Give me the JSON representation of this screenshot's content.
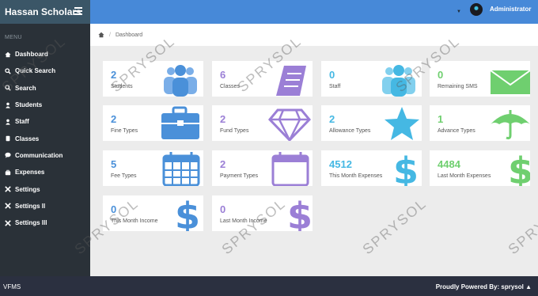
{
  "app": {
    "brand": "Hassan Scholars",
    "footer_left": "VFMS",
    "footer_right": "Proudly Powered By: sprysol"
  },
  "user": {
    "name": "Administrator"
  },
  "sidebar": {
    "menu_label": "MENU",
    "items": [
      {
        "label": "Dashboard",
        "icon": "home-icon"
      },
      {
        "label": "Quick Search",
        "icon": "search-icon"
      },
      {
        "label": "Search",
        "icon": "search-icon"
      },
      {
        "label": "Students",
        "icon": "user-icon"
      },
      {
        "label": "Staff",
        "icon": "user-icon"
      },
      {
        "label": "Classes",
        "icon": "book-icon"
      },
      {
        "label": "Communication",
        "icon": "chat-icon"
      },
      {
        "label": "Expenses",
        "icon": "briefcase-icon"
      },
      {
        "label": "Settings",
        "icon": "tools-icon"
      },
      {
        "label": "Settings ll",
        "icon": "tools-icon"
      },
      {
        "label": "Settings lll",
        "icon": "tools-icon"
      }
    ]
  },
  "breadcrumb": {
    "current": "Dashboard"
  },
  "cards": [
    {
      "value": "2",
      "label": "Students",
      "icon": "users-icon"
    },
    {
      "value": "6",
      "label": "Classes",
      "icon": "book-icon"
    },
    {
      "value": "0",
      "label": "Staff",
      "icon": "users-icon"
    },
    {
      "value": "0",
      "label": "Remaining SMS",
      "icon": "envelope-icon"
    },
    {
      "value": "2",
      "label": "Fine Types",
      "icon": "briefcase-icon"
    },
    {
      "value": "2",
      "label": "Fund Types",
      "icon": "diamond-icon"
    },
    {
      "value": "2",
      "label": "Allowance Types",
      "icon": "star-icon"
    },
    {
      "value": "1",
      "label": "Advance Types",
      "icon": "umbrella-icon"
    },
    {
      "value": "5",
      "label": "Fee Types",
      "icon": "calendar-icon"
    },
    {
      "value": "2",
      "label": "Payment Types",
      "icon": "calendar-icon"
    },
    {
      "value": "4512",
      "label": "This Month Expenses",
      "icon": "dollar-icon"
    },
    {
      "value": "4484",
      "label": "Last Month Expenses",
      "icon": "dollar-icon"
    },
    {
      "value": "0",
      "label": "This Month Income",
      "icon": "dollar-icon"
    },
    {
      "value": "0",
      "label": "Last Month Income",
      "icon": "dollar-icon"
    }
  ],
  "colors": {
    "blue": "#4a90d9",
    "purple": "#9b7fd6",
    "cyan": "#45b8e3",
    "green": "#6fcf6f",
    "sidebar": "#2a3138",
    "topbar": "#4789d8"
  },
  "watermark": "SPRYSOL"
}
